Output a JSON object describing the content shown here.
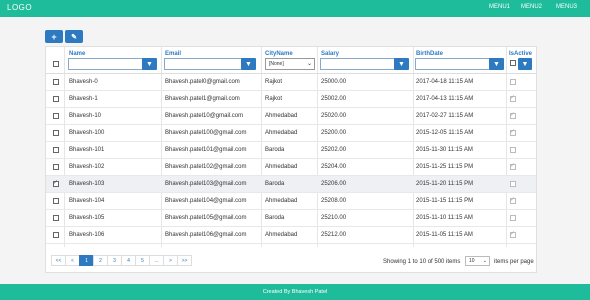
{
  "header": {
    "logo": "LOGO",
    "menu": [
      "MENU1",
      "MENU2",
      "MENU3"
    ]
  },
  "toolbar": {
    "add_symbol": "+",
    "edit_symbol": "✎"
  },
  "grid": {
    "columns": [
      "Name",
      "Email",
      "CityName",
      "Salary",
      "BirthDate",
      "IsActive"
    ],
    "city_filter_value": "[None]",
    "rows": [
      {
        "name": "Bhavesh-0",
        "email": "Bhavesh.patel0@gmail.com",
        "city": "Rajkot",
        "salary": "25000.00",
        "birth": "2017-04-18 11:15 AM",
        "active": false,
        "selected": false
      },
      {
        "name": "Bhavesh-1",
        "email": "Bhavesh.patel1@gmail.com",
        "city": "Rajkot",
        "salary": "25002.00",
        "birth": "2017-04-13 11:15 AM",
        "active": true,
        "selected": false
      },
      {
        "name": "Bhavesh-10",
        "email": "Bhavesh.patel10@gmail.com",
        "city": "Ahmedabad",
        "salary": "25020.00",
        "birth": "2017-02-27 11:15 AM",
        "active": true,
        "selected": false
      },
      {
        "name": "Bhavesh-100",
        "email": "Bhavesh.patel100@gmail.com",
        "city": "Ahmedabad",
        "salary": "25200.00",
        "birth": "2015-12-05 11:15 AM",
        "active": true,
        "selected": false
      },
      {
        "name": "Bhavesh-101",
        "email": "Bhavesh.patel101@gmail.com",
        "city": "Baroda",
        "salary": "25202.00",
        "birth": "2015-11-30 11:15 AM",
        "active": false,
        "selected": false
      },
      {
        "name": "Bhavesh-102",
        "email": "Bhavesh.patel102@gmail.com",
        "city": "Ahmedabad",
        "salary": "25204.00",
        "birth": "2015-11-25 11:15 PM",
        "active": true,
        "selected": false
      },
      {
        "name": "Bhavesh-103",
        "email": "Bhavesh.patel103@gmail.com",
        "city": "Baroda",
        "salary": "25206.00",
        "birth": "2015-11-20 11:15 PM",
        "active": false,
        "selected": true
      },
      {
        "name": "Bhavesh-104",
        "email": "Bhavesh.patel104@gmail.com",
        "city": "Ahmedabad",
        "salary": "25208.00",
        "birth": "2015-11-15 11:15 PM",
        "active": true,
        "selected": false
      },
      {
        "name": "Bhavesh-105",
        "email": "Bhavesh.patel105@gmail.com",
        "city": "Baroda",
        "salary": "25210.00",
        "birth": "2015-11-10 11:15 AM",
        "active": false,
        "selected": false
      },
      {
        "name": "Bhavesh-106",
        "email": "Bhavesh.patel106@gmail.com",
        "city": "Ahmedabad",
        "salary": "25212.00",
        "birth": "2015-11-05 11:15 AM",
        "active": true,
        "selected": false
      }
    ]
  },
  "pager": {
    "buttons": [
      "<<",
      "<",
      "1",
      "2",
      "3",
      "4",
      "5",
      "...",
      ">",
      ">>"
    ],
    "active": "1",
    "showing": "Showing 1 to 10 of 500 items",
    "page_size": "10",
    "per_page_label": "items per page"
  },
  "footer": {
    "text": "Created By Bhavesh Patel"
  },
  "colors": {
    "accent": "#1fbc9c",
    "primary": "#2e7ac0"
  }
}
